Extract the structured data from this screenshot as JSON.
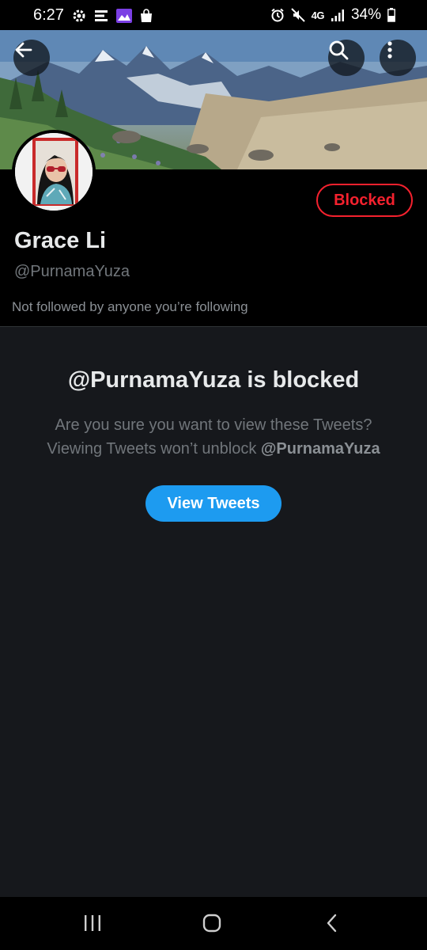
{
  "status_bar": {
    "time": "6:27",
    "network": "4G",
    "battery": "34%"
  },
  "profile": {
    "display_name": "Grace Li",
    "handle": "@PurnamaYuza",
    "followed_by": "Not followed by anyone you’re following",
    "blocked_button": "Blocked",
    "blocked_color": "#f4212e"
  },
  "notice": {
    "title": "@PurnamaYuza is blocked",
    "line1": "Are you sure you want to view these Tweets?",
    "line2_prefix": "Viewing Tweets won’t unblock ",
    "line2_handle": "@PurnamaYuza",
    "view_button": "View Tweets",
    "accent": "#1d9bf0"
  },
  "icons": {
    "back": "arrow-left-icon",
    "search": "search-icon",
    "more": "more-vertical-icon",
    "nav_recents": "recents-icon",
    "nav_home": "home-icon",
    "nav_back": "back-chevron-icon"
  }
}
